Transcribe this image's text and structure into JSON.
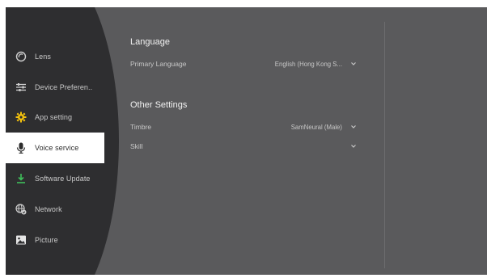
{
  "sidebar": {
    "items": [
      {
        "label": "Lens",
        "icon": "lens-icon",
        "active": false
      },
      {
        "label": "Device Preferen..",
        "icon": "sliders-icon",
        "active": false
      },
      {
        "label": "App setting",
        "icon": "gear-icon",
        "active": false
      },
      {
        "label": "Voice service",
        "icon": "microphone-icon",
        "active": true
      },
      {
        "label": "Software Update",
        "icon": "download-icon",
        "active": false
      },
      {
        "label": "Network",
        "icon": "network-icon",
        "active": false
      },
      {
        "label": "Picture",
        "icon": "picture-icon",
        "active": false
      }
    ]
  },
  "main": {
    "language": {
      "title": "Language",
      "primary_label": "Primary Language",
      "primary_value": "English (Hong Kong S..."
    },
    "other": {
      "title": "Other Settings",
      "timbre_label": "Timbre",
      "timbre_value": "SamNeural (Male)",
      "skill_label": "Skill",
      "skill_value": ""
    }
  },
  "colors": {
    "background": "#5a5a5c",
    "sidebar": "#2e2e30",
    "active_item": "#ffffff",
    "accent_yellow": "#f4c20d",
    "accent_green": "#3fbf5a"
  }
}
